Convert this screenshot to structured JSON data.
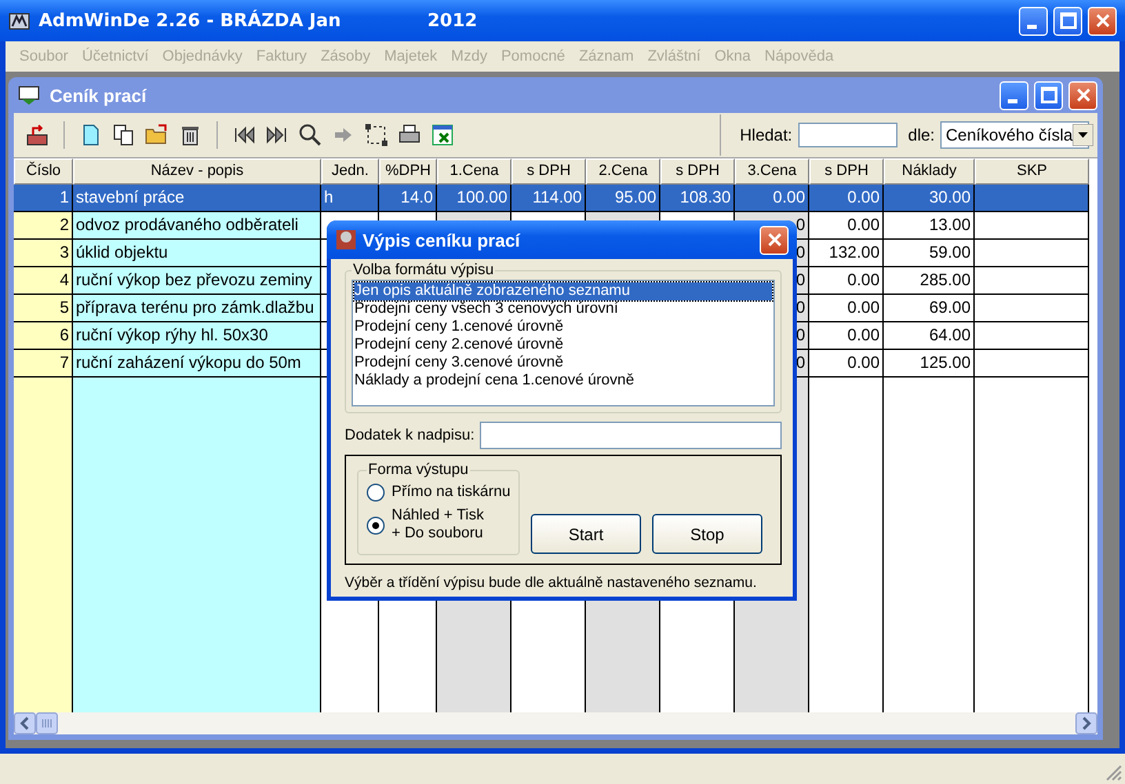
{
  "window": {
    "title": "AdmWinDe 2.26 - BRÁZDA Jan",
    "year": "2012"
  },
  "menu": [
    {
      "label": "Soubor",
      "disabled": true
    },
    {
      "label": "Účetnictví",
      "disabled": true
    },
    {
      "label": "Objednávky",
      "disabled": true
    },
    {
      "label": "Faktury",
      "disabled": true
    },
    {
      "label": "Zásoby",
      "disabled": true
    },
    {
      "label": "Majetek",
      "disabled": true
    },
    {
      "label": "Mzdy",
      "disabled": true
    },
    {
      "label": "Pomocné",
      "disabled": true
    },
    {
      "label": "Záznam",
      "disabled": true
    },
    {
      "label": "Zvláštní",
      "disabled": true
    },
    {
      "label": "Okna",
      "disabled": true
    },
    {
      "label": "Nápověda",
      "disabled": true
    }
  ],
  "child_window": {
    "title": "Ceník prací"
  },
  "search": {
    "label": "Hledat:",
    "by_label": "dle:",
    "by_value": "Ceníkového čísla"
  },
  "table": {
    "columns": [
      {
        "label": "Číslo",
        "kind": "number",
        "color": "#ffffc0"
      },
      {
        "label": "Název - popis",
        "kind": "text",
        "color": "#c0ffff"
      },
      {
        "label": "Jedn.",
        "kind": "text",
        "color": "#ffffff"
      },
      {
        "label": "%DPH",
        "kind": "number",
        "color": "#ffffff"
      },
      {
        "label": "1.Cena",
        "kind": "number",
        "color": "#e0e0e0"
      },
      {
        "label": "s DPH",
        "kind": "number",
        "color": "#ffffff"
      },
      {
        "label": "2.Cena",
        "kind": "number",
        "color": "#e0e0e0"
      },
      {
        "label": "s DPH",
        "kind": "number",
        "color": "#ffffff"
      },
      {
        "label": "3.Cena",
        "kind": "number",
        "color": "#e0e0e0"
      },
      {
        "label": "s DPH",
        "kind": "number",
        "color": "#ffffff"
      },
      {
        "label": "Náklady",
        "kind": "number",
        "color": "#ffffff"
      },
      {
        "label": "SKP",
        "kind": "text",
        "color": "#ffffff"
      }
    ],
    "rows": [
      {
        "selected": true,
        "cells": [
          "1",
          "stavební práce",
          "h",
          "14.0",
          "100.00",
          "114.00",
          "95.00",
          "108.30",
          "0.00",
          "0.00",
          "30.00",
          null
        ]
      },
      {
        "selected": false,
        "cells": [
          "2",
          "odvoz prodávaného odběrateli",
          null,
          null,
          null,
          null,
          null,
          null,
          "0",
          "0.00",
          "13.00",
          null
        ]
      },
      {
        "selected": false,
        "cells": [
          "3",
          "úklid objektu",
          null,
          null,
          null,
          null,
          null,
          null,
          "0",
          "132.00",
          "59.00",
          null
        ]
      },
      {
        "selected": false,
        "cells": [
          "4",
          "ruční výkop bez převozu zeminy",
          null,
          null,
          null,
          null,
          null,
          null,
          "0",
          "0.00",
          "285.00",
          null
        ]
      },
      {
        "selected": false,
        "cells": [
          "5",
          "příprava terénu pro zámk.dlažbu",
          null,
          null,
          null,
          null,
          null,
          null,
          "0",
          "0.00",
          "69.00",
          null
        ]
      },
      {
        "selected": false,
        "cells": [
          "6",
          "ruční výkop rýhy hl. 50x30",
          null,
          null,
          null,
          null,
          null,
          null,
          "0",
          "0.00",
          "64.00",
          null
        ]
      },
      {
        "selected": false,
        "cells": [
          "7",
          "ruční zaházení výkopu do 50m",
          null,
          null,
          null,
          null,
          null,
          null,
          "0",
          "0.00",
          "125.00",
          null
        ]
      }
    ]
  },
  "dialog": {
    "title": "Výpis ceníku prací",
    "format_group": "Volba formátu výpisu",
    "formats": [
      {
        "label": "Jen opis aktuálně zobrazeného seznamu",
        "selected": true
      },
      {
        "label": "Prodejní ceny všech 3 cenových úrovní",
        "selected": false
      },
      {
        "label": "Prodejní ceny 1.cenové úrovně",
        "selected": false
      },
      {
        "label": "Prodejní ceny 2.cenové úrovně",
        "selected": false
      },
      {
        "label": "Prodejní ceny 3.cenové úrovně",
        "selected": false
      },
      {
        "label": "Náklady a prodejní cena 1.cenové úrovně",
        "selected": false
      }
    ],
    "heading_label": "Dodatek k nadpisu:",
    "output_group": "Forma výstupu",
    "outputs": [
      {
        "lines": [
          "Přímo na tiskárnu"
        ],
        "checked": false
      },
      {
        "lines": [
          "Náhled + Tisk",
          "+ Do souboru"
        ],
        "checked": true
      }
    ],
    "buttons": [
      "Start",
      "Stop"
    ],
    "note": "Výběr a třídění výpisu bude dle aktuálně nastaveného seznamu."
  }
}
